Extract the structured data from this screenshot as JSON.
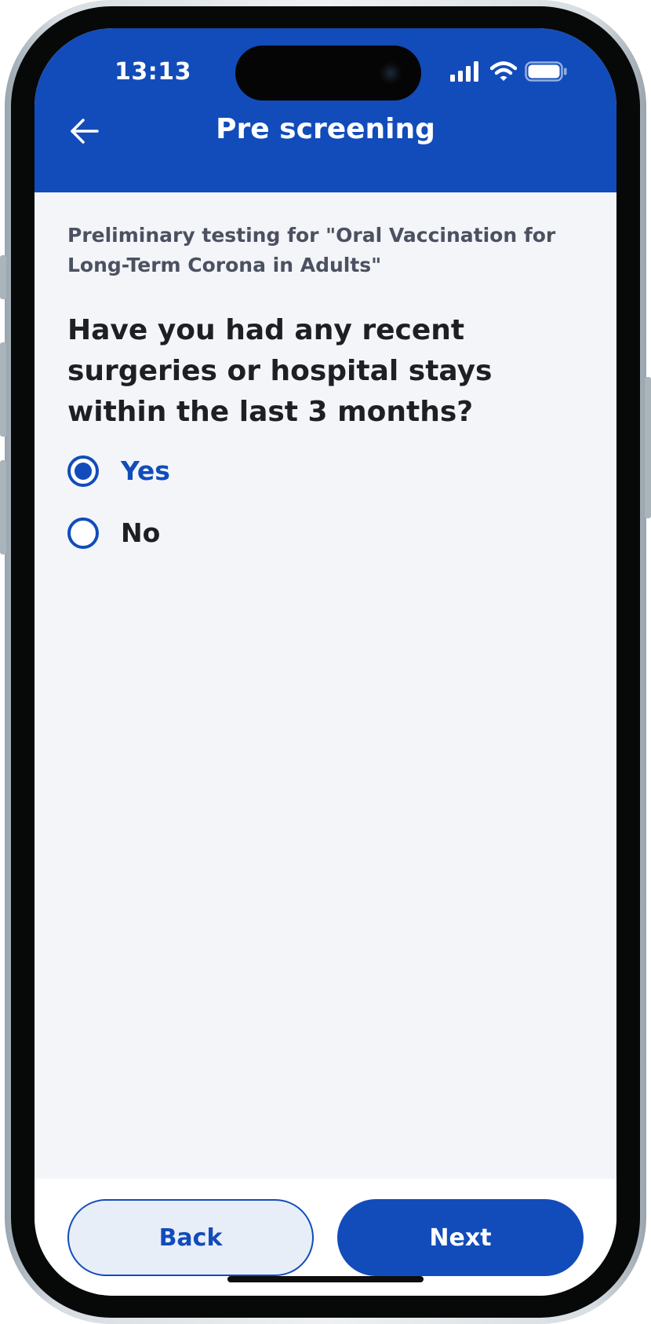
{
  "status_bar": {
    "time": "13:13"
  },
  "header": {
    "title": "Pre screening",
    "back_icon": "arrow-left-icon"
  },
  "intro_text": "Preliminary testing for \"Oral Vaccination for Long-Term Corona in Adults\"",
  "question": "Have you had any recent surgeries or hospital stays within the last 3 months?",
  "options": [
    {
      "label": "Yes",
      "selected": true
    },
    {
      "label": "No",
      "selected": false
    }
  ],
  "footer": {
    "back_label": "Back",
    "next_label": "Next"
  },
  "colors": {
    "primary": "#124cba",
    "background": "#f3f5f9",
    "secondary_button_bg": "#e8eef8",
    "text_dark": "#1d1f24",
    "text_muted": "#4b5160"
  }
}
